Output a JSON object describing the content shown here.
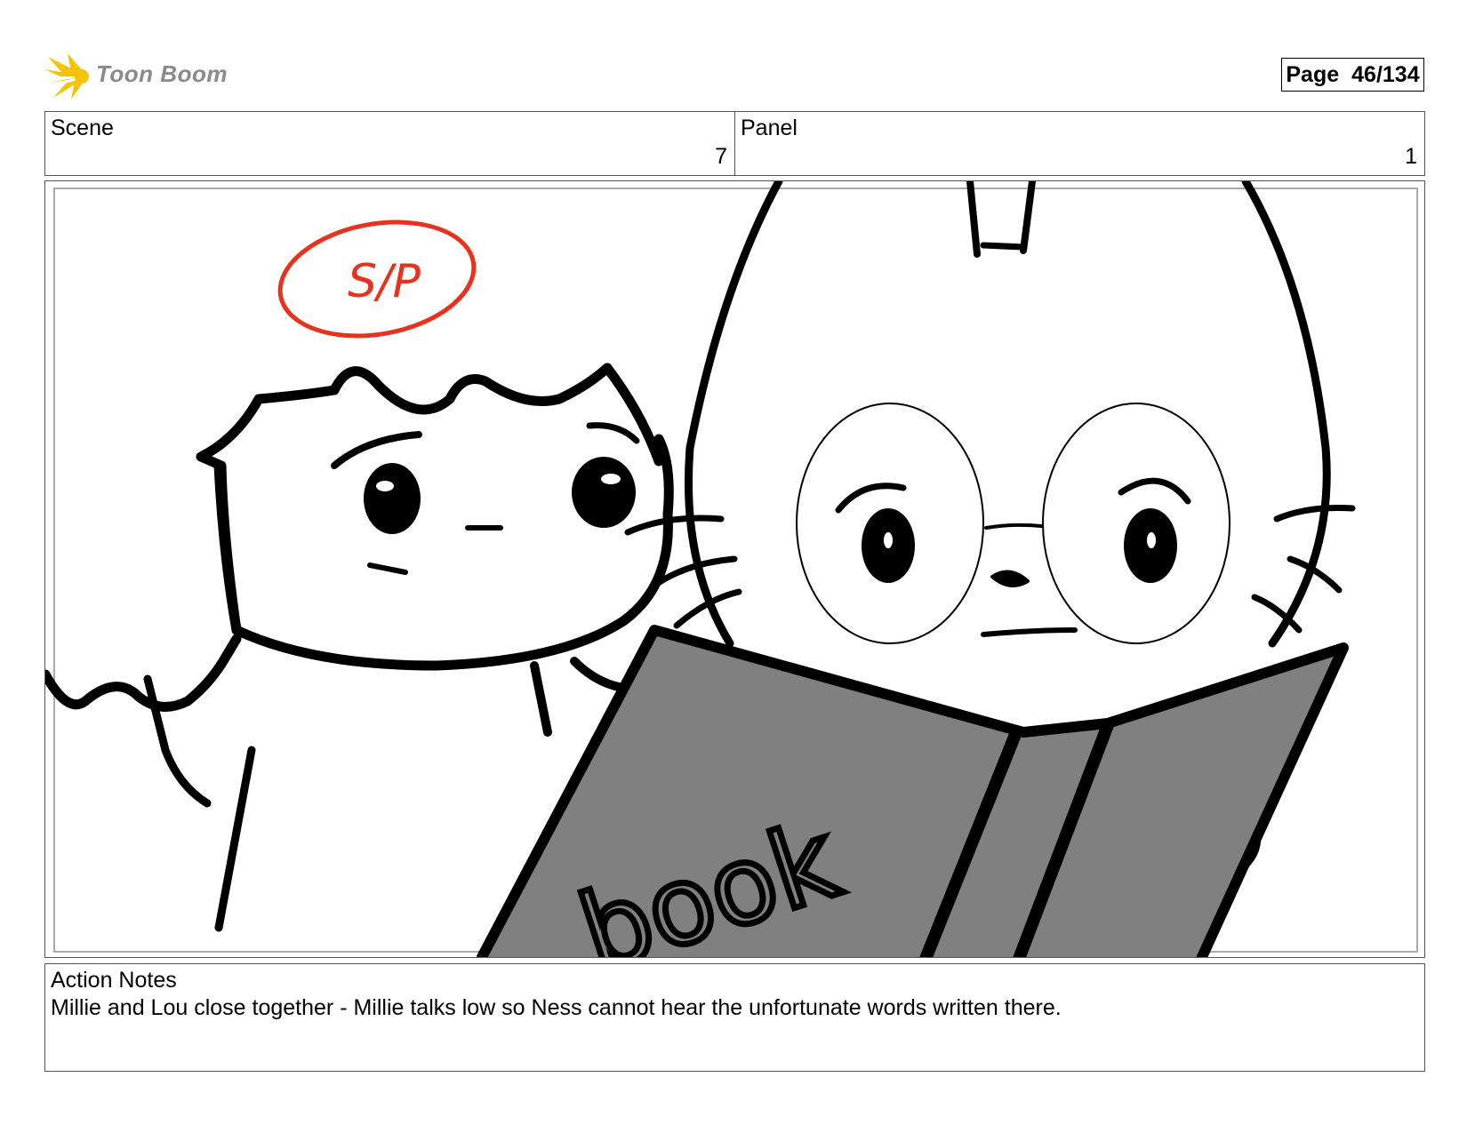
{
  "logo": {
    "text": "Toon Boom",
    "icon": "starburst-icon"
  },
  "page": {
    "label": "Page",
    "number": "46/134"
  },
  "header": {
    "scene_label": "Scene",
    "scene_value": "7",
    "panel_label": "Panel",
    "panel_value": "1"
  },
  "drawing": {
    "annotation": "S/P",
    "book_text": "book"
  },
  "notes": {
    "label": "Action Notes",
    "text": "Millie and Lou close together - Millie talks low so Ness cannot hear the unfortunate words written there."
  },
  "colors": {
    "annotation_red": "#e8321e",
    "logo_yellow": "#f5c400",
    "book_gray": "#808080"
  }
}
